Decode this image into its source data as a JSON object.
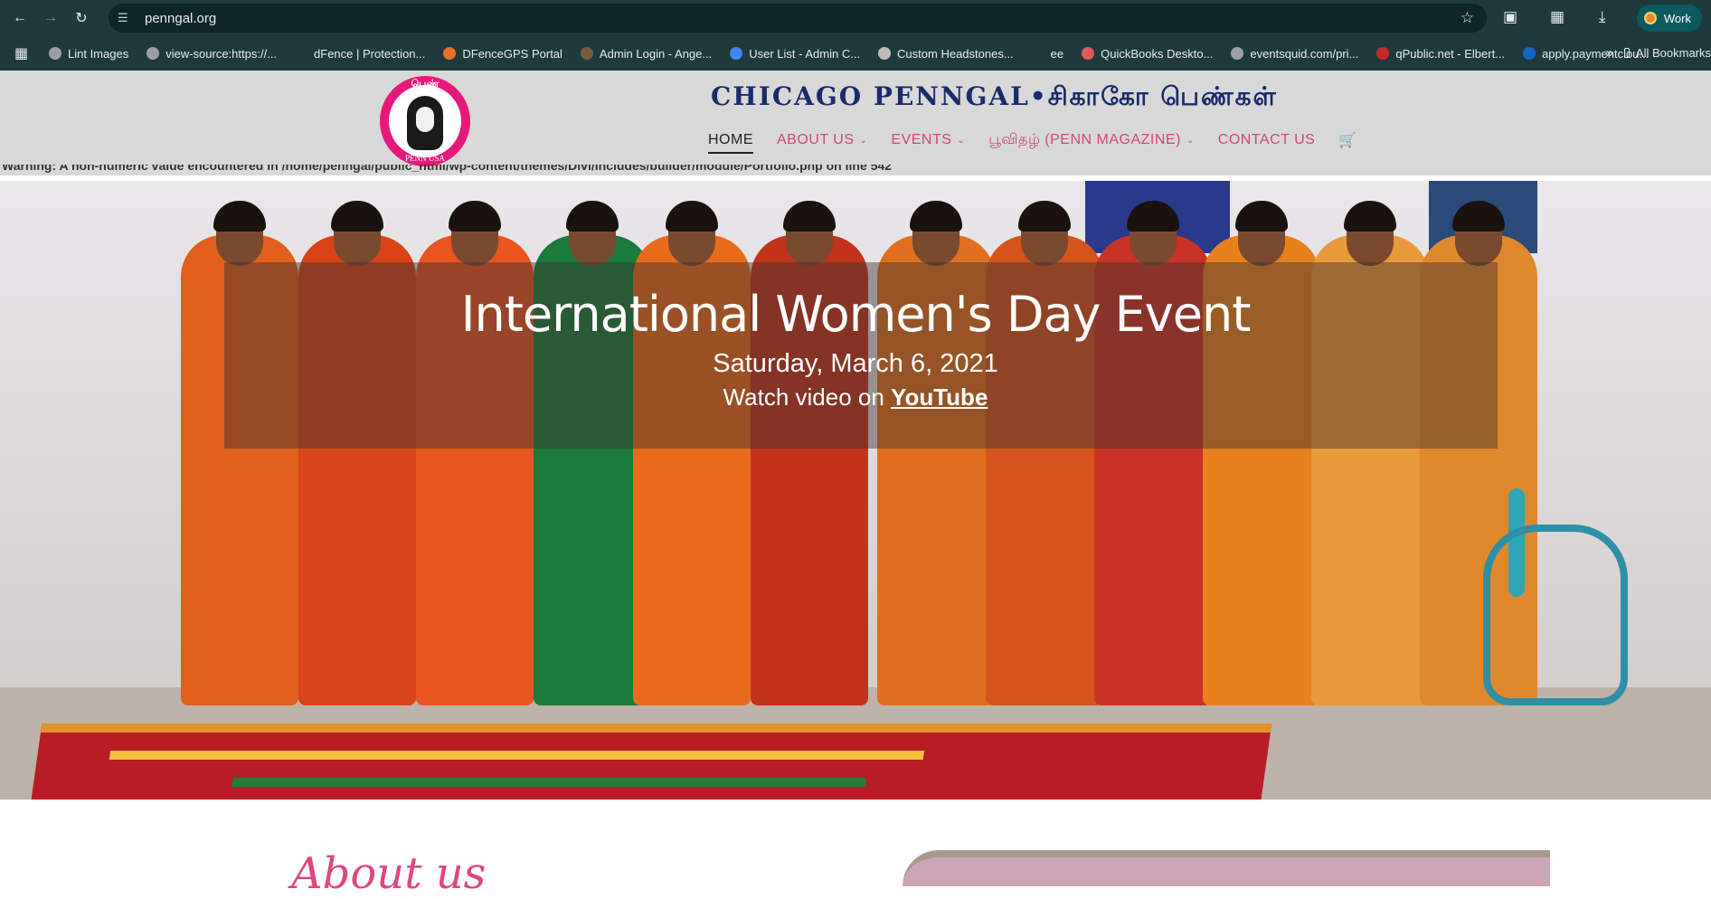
{
  "browser": {
    "url": "penngal.org",
    "profile_label": "Work"
  },
  "bookmarks": [
    {
      "label": "Lint Images",
      "color": "#9aa0a6"
    },
    {
      "label": "view-source:https://...",
      "color": "#9aa0a6"
    },
    {
      "label": "dFence | Protection...",
      "color": "#1f3a3d"
    },
    {
      "label": "DFenceGPS Portal",
      "color": "#e8712b"
    },
    {
      "label": "Admin Login - Ange...",
      "color": "#7a5a3a"
    },
    {
      "label": "User List - Admin C...",
      "color": "#4285f4"
    },
    {
      "label": "Custom Headstones...",
      "color": "#bdbdbd"
    },
    {
      "label": "ee",
      "color": "#1f3a3d"
    },
    {
      "label": "QuickBooks Deskto...",
      "color": "#e05a5a"
    },
    {
      "label": "eventsquid.com/pri...",
      "color": "#9aa0a6"
    },
    {
      "label": "qPublic.net - Elbert...",
      "color": "#c62828"
    },
    {
      "label": "apply.paymentclou...",
      "color": "#1565c0"
    }
  ],
  "bookmarks_all_label": "All Bookmarks",
  "site": {
    "logo_top": "பெண்",
    "logo_bottom": "PENN USA",
    "title": "CHICAGO PENNGAL•சிகாகோ பெண்கள்",
    "menu": [
      {
        "label": "HOME",
        "active": true,
        "has_dropdown": false
      },
      {
        "label": "ABOUT US",
        "active": false,
        "has_dropdown": true
      },
      {
        "label": "EVENTS",
        "active": false,
        "has_dropdown": true
      },
      {
        "label": "பூவிதழ் (PENN MAGAZINE)",
        "active": false,
        "has_dropdown": true
      },
      {
        "label": "CONTACT US",
        "active": false,
        "has_dropdown": false
      }
    ],
    "warning_text": "Warning: A non-numeric value encountered in /home/penngal/public_html/wp-content/themes/Divi/includes/builder/module/Portfolio.php on line 542"
  },
  "hero": {
    "title": "International Women's Day Event",
    "date": "Saturday, March 6, 2021",
    "watch_prefix": "Watch video on ",
    "watch_link": "YouTube"
  },
  "about": {
    "heading": "About us"
  },
  "colors": {
    "accent_pink": "#d4457a",
    "title_navy": "#1a2a6c",
    "chrome_bg": "#1f3a3d"
  }
}
